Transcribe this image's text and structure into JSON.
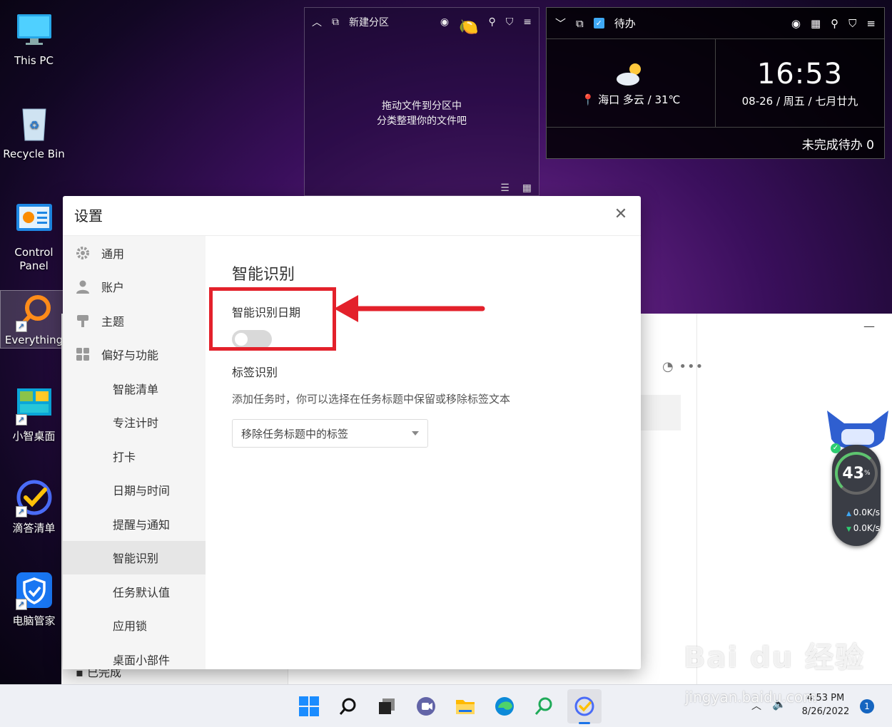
{
  "desktop": {
    "icons": [
      {
        "label": "This PC"
      },
      {
        "label": "Recycle Bin"
      },
      {
        "label": "Control Panel"
      },
      {
        "label": "Everything"
      },
      {
        "label": "小智桌面"
      },
      {
        "label": "滴答清单"
      },
      {
        "label": "电脑管家"
      }
    ]
  },
  "fence": {
    "title": "新建分区",
    "hint_line1": "拖动文件到分区中",
    "hint_line2": "分类整理你的文件吧"
  },
  "todo_widget": {
    "title": "待办",
    "location": "海口",
    "weather": "多云 / 31℃",
    "time": "16:53",
    "date": "08-26 / 周五 / 七月廿九",
    "pending": "未完成待办 0"
  },
  "settings": {
    "title": "设置",
    "nav": [
      {
        "label": "通用",
        "icon": "gear-icon"
      },
      {
        "label": "账户",
        "icon": "user-icon"
      },
      {
        "label": "主题",
        "icon": "brush-icon"
      },
      {
        "label": "偏好与功能",
        "icon": "grid-icon"
      }
    ],
    "sub_nav": [
      "智能清单",
      "专注计时",
      "打卡",
      "日期与时间",
      "提醒与通知",
      "智能识别",
      "任务默认值",
      "应用锁",
      "桌面小部件"
    ],
    "active_item": "智能识别",
    "section_title": "智能识别",
    "date_recognition_label": "智能识别日期",
    "date_recognition_enabled": false,
    "tag_recognition_label": "标签识别",
    "tag_recognition_desc": "添加任务时，你可以选择在任务标题中保留或移除标签文本",
    "tag_select_value": "移除任务标题中的标签"
  },
  "background_app": {
    "completed_label": "已完成"
  },
  "speed_widget": {
    "percent": "43",
    "unit": "%",
    "upload": "0.0K/s",
    "download": "0.0K/s"
  },
  "taskbar": {
    "time": "4:53 PM",
    "date": "8/26/2022",
    "notifications": "1"
  },
  "watermark": {
    "text": "Bai du 经验",
    "sub": "jingyan.baidu.com"
  },
  "colors": {
    "annotation": "#e3212b",
    "accent": "#1a73e8"
  }
}
